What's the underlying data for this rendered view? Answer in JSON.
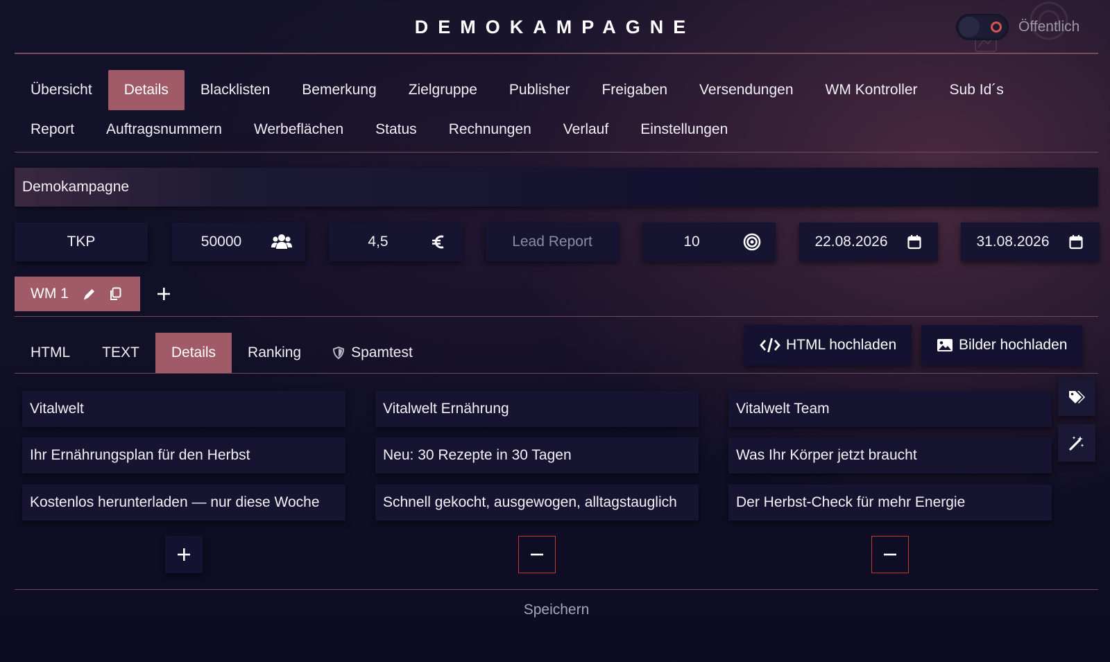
{
  "header": {
    "title": "DEMOKAMPAGNE",
    "visibility_label": "Öffentlich"
  },
  "nav": {
    "row1": [
      "Übersicht",
      "Details",
      "Blacklisten",
      "Bemerkung",
      "Zielgruppe",
      "Publisher",
      "Freigaben",
      "Versendungen",
      "WM Kontroller",
      "Sub Id´s"
    ],
    "row2": [
      "Report",
      "Auftragsnummern",
      "Werbeflächen",
      "Status",
      "Rechnungen",
      "Verlauf",
      "Einstellungen"
    ],
    "active": "Details"
  },
  "campaign": {
    "name": "Demokampagne"
  },
  "fields": {
    "pricing_model": "TKP",
    "volume": "50000",
    "price": "4,5",
    "report_placeholder": "Lead Report",
    "target": "10",
    "start_date": "22.08.2026",
    "end_date": "31.08.2026"
  },
  "wm": {
    "tab_label": "WM 1"
  },
  "subtabs": {
    "items": [
      "HTML",
      "TEXT",
      "Details",
      "Ranking",
      "Spamtest"
    ],
    "active": "Details"
  },
  "uploads": {
    "html_label": "HTML hochladen",
    "images_label": "Bilder hochladen"
  },
  "details": {
    "columns": [
      [
        "Vitalwelt",
        "Ihr Ernährungsplan für den Herbst",
        "Kostenlos herunterladen — nur diese Woche"
      ],
      [
        "Vitalwelt Ernährung",
        "Neu: 30 Rezepte in 30 Tagen",
        "Schnell gekocht, ausgewogen, alltagstauglich"
      ],
      [
        "Vitalwelt Team",
        "Was Ihr Körper jetzt braucht",
        "Der Herbst-Check für mehr Energie"
      ]
    ]
  },
  "footer": {
    "save_label": "Speichern"
  },
  "colors": {
    "accent": "#a05a68",
    "background": "#121029",
    "danger": "#c0392b"
  }
}
